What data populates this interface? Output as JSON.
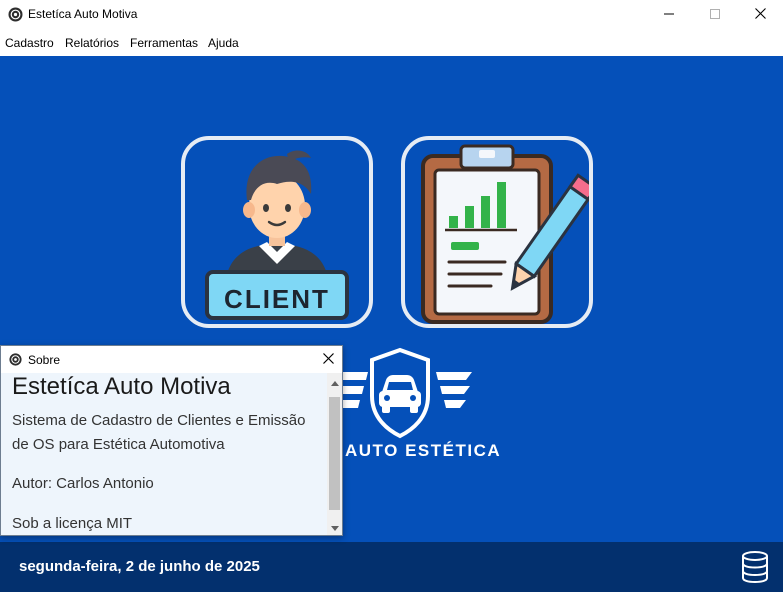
{
  "window": {
    "title": "Estetíca Auto Motiva",
    "icon": "app-logo-icon",
    "controls": [
      "minimize-icon",
      "maximize-icon",
      "close-icon"
    ]
  },
  "menu": {
    "items": [
      {
        "label": "Cadastro"
      },
      {
        "label": "Relatórios"
      },
      {
        "label": "Ferramentas"
      },
      {
        "label": "Ajuda"
      }
    ]
  },
  "main": {
    "background": "#0550b9",
    "tiles": [
      {
        "icon": "client-icon",
        "badge_text": "CLIENT"
      },
      {
        "icon": "report-clipboard-icon"
      }
    ],
    "logo_text": "AUTO ESTÉTICA"
  },
  "footer": {
    "date": "segunda-feira, 2 de junho de 2025",
    "icon": "database-icon",
    "background": "#03306e"
  },
  "dialog": {
    "title": "Sobre",
    "heading": "Estetíca Auto Motiva",
    "description": "Sistema de Cadastro de Clientes e Emissão de OS para Estética Automotiva",
    "author": "Autor: Carlos Antonio",
    "license": "Sob a licença MIT"
  }
}
